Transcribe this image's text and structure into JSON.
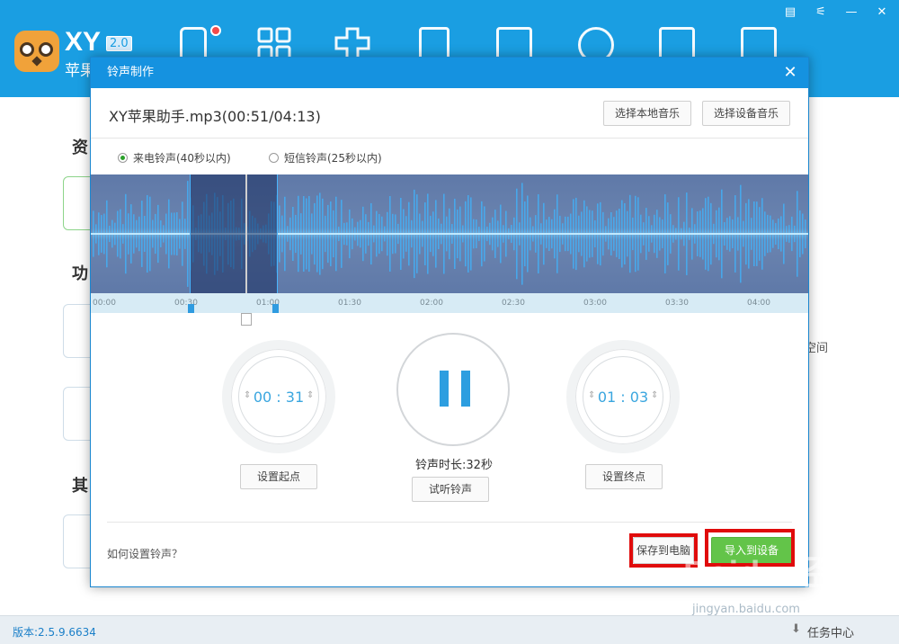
{
  "app": {
    "brand": "XY",
    "version_badge": "2.0",
    "brand_sub": "苹果"
  },
  "window_controls": [
    "▤",
    "⚟",
    "—",
    "✕"
  ],
  "background": {
    "section1": "资",
    "section2": "功",
    "section3": "其",
    "right_text": "空间",
    "version": "版本:2.5.9.6634",
    "task_center": "任务中心"
  },
  "dialog": {
    "title": "铃声制作",
    "close": "✕",
    "file_name": "XY苹果助手.mp3(00:51/04:13)",
    "btn_local": "选择本地音乐",
    "btn_device": "选择设备音乐",
    "radio_call": "来电铃声(40秒以内)",
    "radio_sms": "短信铃声(25秒以内)",
    "ticks": [
      "00:00",
      "00:30",
      "01:00",
      "01:30",
      "02:00",
      "02:30",
      "03:00",
      "03:30",
      "04:00"
    ],
    "start_time": "00 : 31",
    "end_time": "01 : 03",
    "btn_set_start": "设置起点",
    "btn_set_end": "设置终点",
    "duration": "铃声时长:32秒",
    "btn_preview": "试听铃声",
    "help": "如何设置铃声？",
    "btn_save": "保存到电脑",
    "btn_import": "导入到设备"
  },
  "watermark": {
    "main": "Baidu 经验",
    "sub": "jingyan.baidu.com"
  },
  "colors": {
    "header": "#1a9ee2",
    "dialog_title": "#1592e0",
    "accent": "#2d9ee0",
    "import_button": "#63c449",
    "highlight": "#e00b0b"
  }
}
